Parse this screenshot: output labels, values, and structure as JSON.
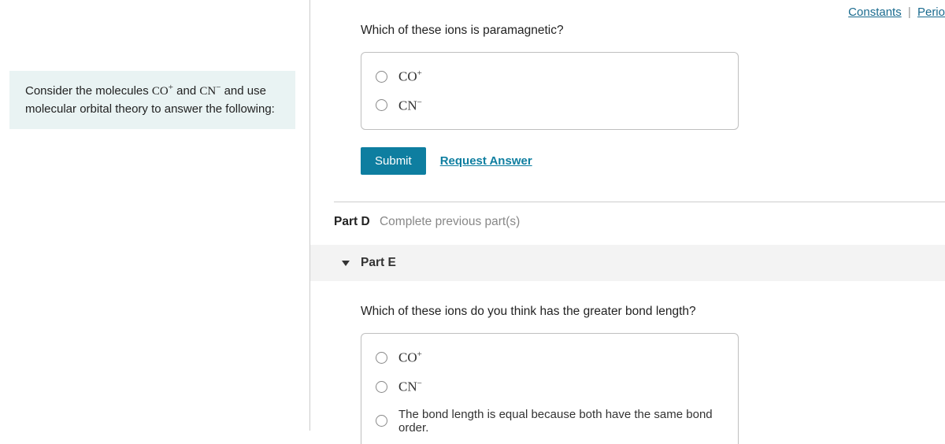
{
  "topLinks": {
    "constants": "Constants",
    "periodic": "Perio"
  },
  "leftPrompt": {
    "pre": "Consider the molecules ",
    "mol1": "CO",
    "mol1sup": "+",
    "mid1": " and ",
    "mol2": "CN",
    "mol2sup": "−",
    "post": " and use molecular orbital theory to answer the following:"
  },
  "partC": {
    "question": "Which of these ions is paramagnetic?",
    "choices": [
      {
        "base": "CO",
        "sup": "+"
      },
      {
        "base": "CN",
        "sup": "−"
      }
    ],
    "submit": "Submit",
    "request": "Request Answer"
  },
  "partD": {
    "label": "Part D",
    "msg": "Complete previous part(s)"
  },
  "partE": {
    "label": "Part E",
    "question": "Which of these ions do you think has the greater bond length?",
    "choices": [
      {
        "base": "CO",
        "sup": "+"
      },
      {
        "base": "CN",
        "sup": "−"
      },
      {
        "text": "The bond length is equal because both have the same bond order."
      }
    ]
  }
}
